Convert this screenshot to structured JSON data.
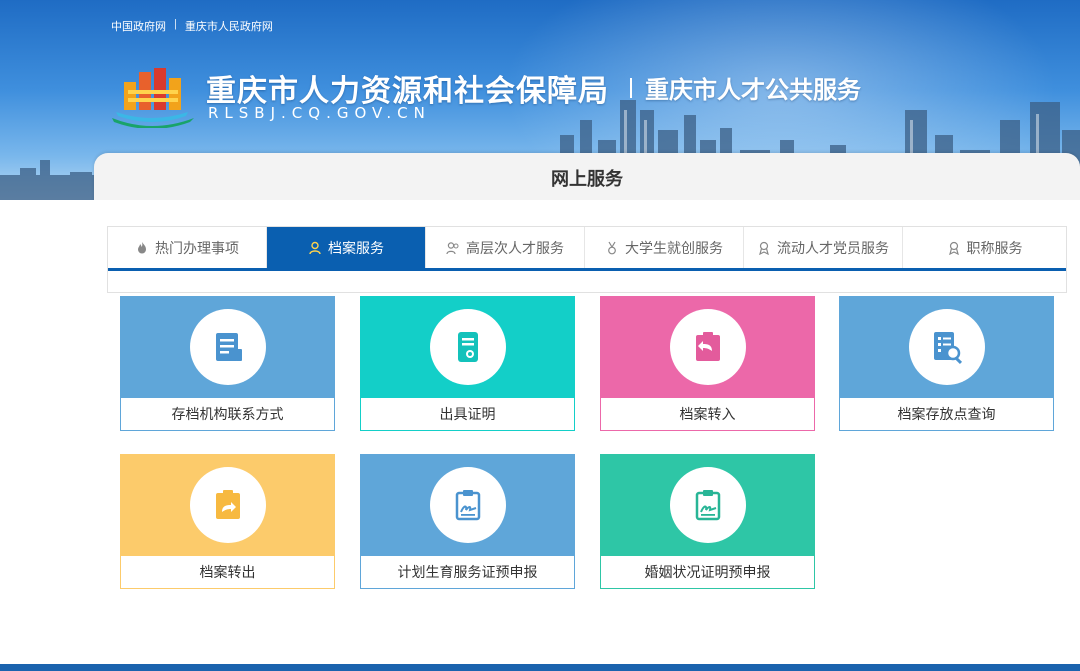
{
  "top_links": [
    "中国政府网",
    "重庆市人民政府网"
  ],
  "top_links_separator": "|",
  "header": {
    "title": "重庆市人力资源和社会保障局",
    "subtitle": "重庆市人才公共服务",
    "domain": "RLSBJ.CQ.GOV.CN",
    "section_tab": "网上服务"
  },
  "nav": {
    "items": [
      {
        "label": "热门办理事项",
        "icon": "flame-icon",
        "active": false
      },
      {
        "label": "档案服务",
        "icon": "person-icon",
        "active": true
      },
      {
        "label": "高层次人才服务",
        "icon": "user-group-icon",
        "active": false
      },
      {
        "label": "大学生就创服务",
        "icon": "medal-icon",
        "active": false
      },
      {
        "label": "流动人才党员服务",
        "icon": "ribbon-icon",
        "active": false
      },
      {
        "label": "职称服务",
        "icon": "ribbon-icon",
        "active": false
      }
    ]
  },
  "cards": [
    {
      "label": "存档机构联系方式",
      "color": "#5fa6d9",
      "icon": "document-icon"
    },
    {
      "label": "出具证明",
      "color": "#13cfc8",
      "icon": "certificate-icon"
    },
    {
      "label": "档案转入",
      "color": "#ec68a9",
      "icon": "clipboard-return-icon"
    },
    {
      "label": "档案存放点查询",
      "color": "#5fa6d9",
      "icon": "document-search-icon"
    },
    {
      "label": "档案转出",
      "color": "#fccb6b",
      "icon": "clipboard-forward-icon"
    },
    {
      "label": "计划生育服务证预申报",
      "color": "#5fa6d9",
      "icon": "clipboard-sign-icon"
    },
    {
      "label": "婚姻状况证明预申报",
      "color": "#2ec6a6",
      "icon": "clipboard-sign-icon"
    }
  ],
  "colors": {
    "nav_active": "#0a5fb0",
    "footer": "#1a63ae"
  }
}
